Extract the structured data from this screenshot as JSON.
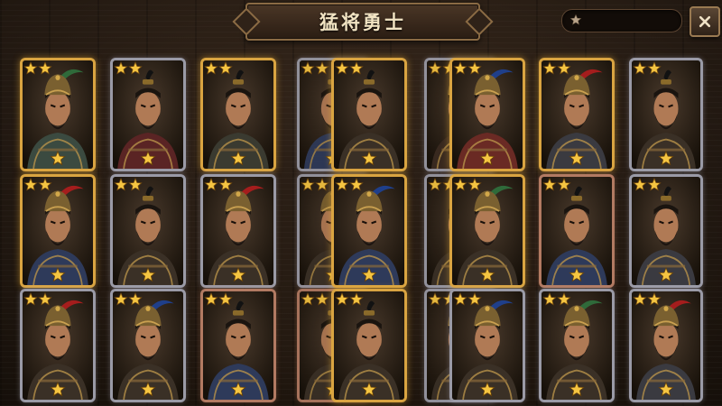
{
  "header": {
    "title": "猛将勇士",
    "filter_icon": "star-filter-icon",
    "close_icon": "close-icon"
  },
  "colors": {
    "gold_frame": "#d9a441",
    "silver_frame": "#9a9aa6",
    "bronze_frame": "#b27a62",
    "star": "#f5c542"
  },
  "cards": [
    {
      "frame": "gold",
      "helmet": "plume-green",
      "armor": "#3b4a40"
    },
    {
      "frame": "silver",
      "helmet": "topknot",
      "armor": "#5a2424"
    },
    {
      "frame": "gold",
      "helmet": "topknot",
      "armor": "#3a3a30"
    },
    {
      "frame": "silver",
      "helmet": "topknot",
      "armor": "#2e3a5a"
    },
    {
      "frame": "gold",
      "helmet": "topknot",
      "armor": "#3a3026"
    },
    {
      "frame": "silver",
      "helmet": "plume-blue",
      "armor": "#3a2a20"
    },
    {
      "frame": "gold",
      "helmet": "plume-blue",
      "armor": "#6a2a24"
    },
    {
      "frame": "gold",
      "helmet": "plume-red",
      "armor": "#3a3a40"
    },
    {
      "frame": "silver",
      "helmet": "topknot",
      "armor": "#3a3026"
    },
    {
      "frame": "gold",
      "helmet": "plume-red",
      "armor": "#2e3a5a"
    },
    {
      "frame": "silver",
      "helmet": "topknot",
      "armor": "#3a3026"
    },
    {
      "frame": "silver",
      "helmet": "plume-red",
      "armor": "#3a3026"
    },
    {
      "frame": "silver",
      "helmet": "plume-green",
      "armor": "#3a3026"
    },
    {
      "frame": "gold",
      "helmet": "plume-blue",
      "armor": "#2e3a5a"
    },
    {
      "frame": "silver",
      "helmet": "topknot",
      "armor": "#3a3026"
    },
    {
      "frame": "gold",
      "helmet": "plume-green",
      "armor": "#3a3026"
    },
    {
      "frame": "bronze",
      "helmet": "topknot",
      "armor": "#2e3a5a"
    },
    {
      "frame": "silver",
      "helmet": "topknot",
      "armor": "#3a3a40"
    },
    {
      "frame": "silver",
      "helmet": "plume-red",
      "armor": "#3a3026"
    },
    {
      "frame": "silver",
      "helmet": "plume-blue",
      "armor": "#3a3026"
    },
    {
      "frame": "bronze",
      "helmet": "topknot",
      "armor": "#2e3a5a"
    },
    {
      "frame": "bronze",
      "helmet": "topknot",
      "armor": "#3a3026"
    },
    {
      "frame": "gold",
      "helmet": "topknot",
      "armor": "#3a3026"
    },
    {
      "frame": "silver",
      "helmet": "plume-red",
      "armor": "#3a3026"
    },
    {
      "frame": "silver",
      "helmet": "plume-blue",
      "armor": "#3a3026"
    },
    {
      "frame": "silver",
      "helmet": "plume-green",
      "armor": "#3a3026"
    },
    {
      "frame": "silver",
      "helmet": "plume-red",
      "armor": "#3a3a40"
    }
  ]
}
